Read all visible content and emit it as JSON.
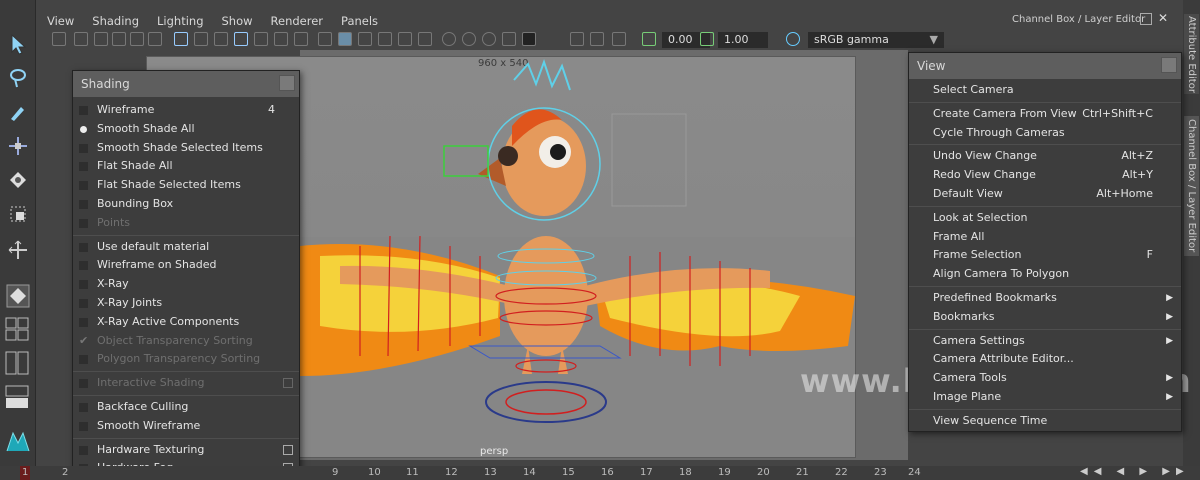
{
  "menubar": {
    "items": [
      "View",
      "Shading",
      "Lighting",
      "Show",
      "Renderer",
      "Panels"
    ]
  },
  "toolbar": {
    "exposure": "0.00",
    "gamma": "1.00",
    "color_space": "sRGB gamma"
  },
  "channel_box": {
    "title": "Channel Box / Layer Editor",
    "vtab_attribute": "Attribute Editor",
    "vtab_channel": "Channel Box / Layer Editor"
  },
  "viewport": {
    "resolution_gate": "960 x 540",
    "camera": "persp",
    "watermark": "www.honaramiz.com"
  },
  "shading_menu": {
    "title": "Shading",
    "items": [
      {
        "label": "Wireframe",
        "hotkey": "4"
      },
      {
        "label": "Smooth Shade All"
      },
      {
        "label": "Smooth Shade Selected Items"
      },
      {
        "label": "Flat Shade All"
      },
      {
        "label": "Flat Shade Selected Items"
      },
      {
        "label": "Bounding Box"
      },
      {
        "label": "Points"
      },
      {
        "label": "Use default material"
      },
      {
        "label": "Wireframe on Shaded"
      },
      {
        "label": "X-Ray"
      },
      {
        "label": "X-Ray Joints"
      },
      {
        "label": "X-Ray Active Components"
      },
      {
        "label": "Object Transparency Sorting"
      },
      {
        "label": "Polygon Transparency Sorting"
      },
      {
        "label": "Interactive Shading"
      },
      {
        "label": "Backface Culling"
      },
      {
        "label": "Smooth Wireframe"
      },
      {
        "label": "Hardware Texturing"
      },
      {
        "label": "Hardware Fog"
      }
    ]
  },
  "view_menu": {
    "title": "View",
    "items": [
      {
        "label": "Select Camera"
      },
      {
        "label": "Create Camera From View",
        "shortcut": "Ctrl+Shift+C"
      },
      {
        "label": "Cycle Through Cameras"
      },
      {
        "label": "Undo View Change",
        "shortcut": "Alt+Z"
      },
      {
        "label": "Redo View Change",
        "shortcut": "Alt+Y"
      },
      {
        "label": "Default View",
        "shortcut": "Alt+Home"
      },
      {
        "label": "Look at Selection"
      },
      {
        "label": "Frame All"
      },
      {
        "label": "Frame Selection",
        "shortcut": "F"
      },
      {
        "label": "Align Camera To Polygon"
      },
      {
        "label": "Predefined Bookmarks"
      },
      {
        "label": "Bookmarks"
      },
      {
        "label": "Camera Settings"
      },
      {
        "label": "Camera Attribute Editor..."
      },
      {
        "label": "Camera Tools"
      },
      {
        "label": "Image Plane"
      },
      {
        "label": "View Sequence Time"
      }
    ]
  },
  "timeline": {
    "start": "1",
    "ticks": [
      "2",
      "9",
      "10",
      "11",
      "12",
      "13",
      "14",
      "15",
      "16",
      "17",
      "18",
      "19",
      "20",
      "21",
      "22",
      "23",
      "24"
    ]
  },
  "colors": {
    "selection_red": "#d11f1f",
    "control_cyan": "#5fd0e8",
    "feather_orange": "#f08a14",
    "feather_yellow": "#f5d23a",
    "skin": "#e59a5c"
  }
}
